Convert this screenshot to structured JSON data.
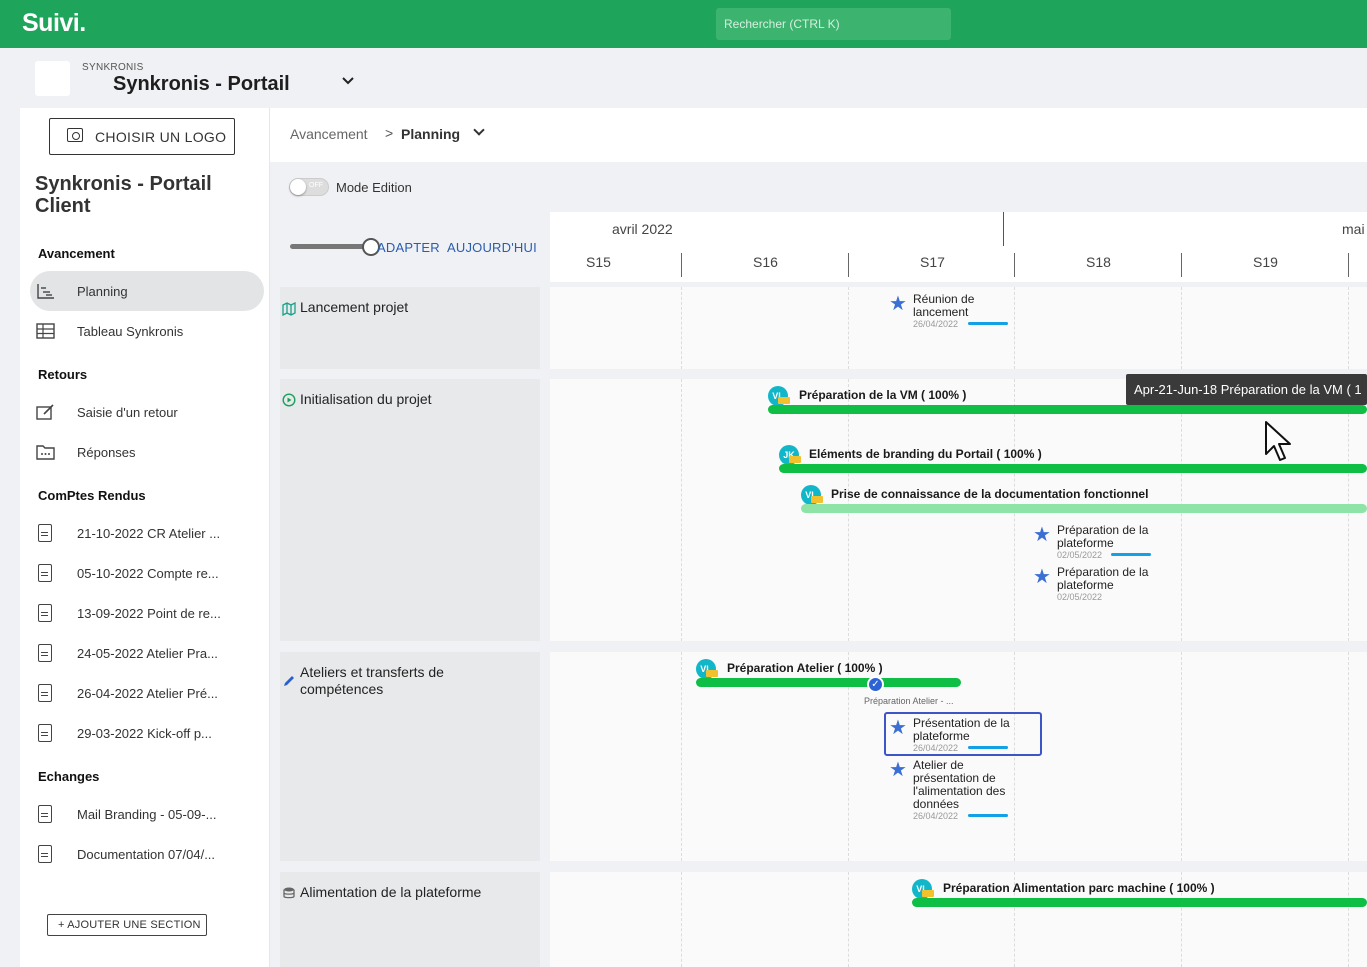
{
  "topbar": {
    "logo": "Suivi.",
    "search_placeholder": "Rechercher (CTRL K)",
    "brand_color": "#1fa45b"
  },
  "project": {
    "org": "SYNKRONIS",
    "title": "Synkronis - Portail"
  },
  "sidebar": {
    "logo_button": "CHOISIR UN LOGO",
    "title": "Synkronis - Portail Client",
    "sections": [
      {
        "heading": "Avancement",
        "items": [
          {
            "label": "Planning",
            "icon": "gantt-icon",
            "active": true
          },
          {
            "label": "Tableau Synkronis",
            "icon": "table-icon"
          }
        ]
      },
      {
        "heading": "Retours",
        "items": [
          {
            "label": "Saisie d'un retour",
            "icon": "edit-form-icon"
          },
          {
            "label": "Réponses",
            "icon": "folder-icon"
          }
        ]
      },
      {
        "heading": "ComPtes Rendus",
        "items": [
          {
            "label": "21-10-2022 CR Atelier ...",
            "icon": "document-icon"
          },
          {
            "label": "05-10-2022 Compte re...",
            "icon": "document-icon"
          },
          {
            "label": "13-09-2022 Point de re...",
            "icon": "document-icon"
          },
          {
            "label": "24-05-2022 Atelier Pra...",
            "icon": "document-icon"
          },
          {
            "label": "26-04-2022 Atelier Pré...",
            "icon": "document-icon"
          },
          {
            "label": "29-03-2022 Kick-off p...",
            "icon": "document-icon"
          }
        ]
      },
      {
        "heading": "Echanges",
        "items": [
          {
            "label": "Mail Branding - 05-09-...",
            "icon": "document-icon"
          },
          {
            "label": "Documentation 07/04/...",
            "icon": "document-icon"
          }
        ]
      }
    ],
    "add_section": "+ AJOUTER UNE SECTION"
  },
  "breadcrumb": {
    "parent": "Avancement",
    "separator": ">",
    "current": "Planning"
  },
  "toolbar": {
    "toggle_state": "OFF",
    "mode_label": "Mode Edition",
    "adapt": "ADAPTER",
    "today": "AUJOURD'HUI"
  },
  "timeline": {
    "months": [
      "avril 2022",
      "mai"
    ],
    "weeks": [
      "S15",
      "S16",
      "S17",
      "S18",
      "S19"
    ]
  },
  "rows": [
    {
      "title": "Lancement projet",
      "icon": "map-icon"
    },
    {
      "title": "Initialisation du projet",
      "icon": "play-circle-icon"
    },
    {
      "title": "Ateliers et transferts de compétences",
      "icon": "pencil-icon"
    },
    {
      "title": "Alimentation de la plateforme",
      "icon": "database-icon"
    }
  ],
  "tasks": {
    "vm": {
      "label": "Préparation de la VM ( 100% )",
      "avatar": "VL",
      "progress": 1.0
    },
    "branding": {
      "label": "Eléments de branding du Portail ( 100% )",
      "avatar": "JK",
      "progress": 1.0
    },
    "docs": {
      "label": "Prise de connaissance de la documentation fonctionnel",
      "avatar": "VL"
    },
    "atelier": {
      "label": "Préparation Atelier ( 100% )",
      "avatar": "VL",
      "progress": 1.0,
      "caption": "Préparation Atelier - ..."
    },
    "alimentation": {
      "label": "Préparation Alimentation parc machine ( 100% )",
      "avatar": "VL",
      "progress": 1.0
    }
  },
  "milestones": {
    "reunion": {
      "title": "Réunion de lancement",
      "date": "26/04/2022"
    },
    "plateforme1": {
      "title": "Préparation de la plateforme",
      "date": "02/05/2022"
    },
    "plateforme2": {
      "title": "Préparation de la plateforme",
      "date": "02/05/2022"
    },
    "presentation": {
      "title": "Présentation de la plateforme",
      "date": "26/04/2022"
    },
    "atelier_pres": {
      "title": "Atelier de présentation de l'alimentation des données",
      "date": "26/04/2022"
    }
  },
  "tooltip": "Apr-21-Jun-18 Préparation de la VM ( 1"
}
